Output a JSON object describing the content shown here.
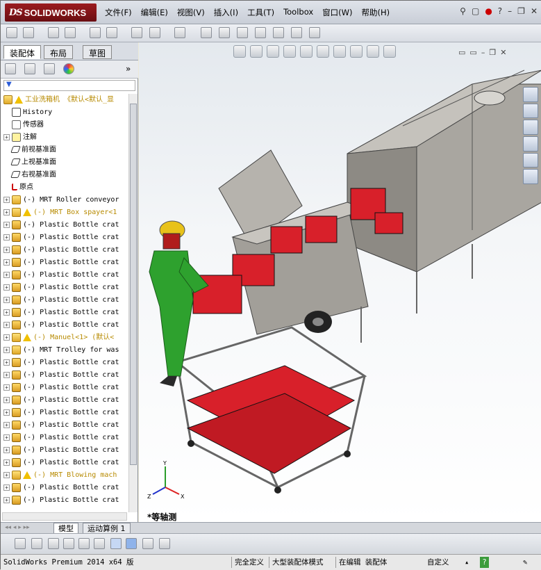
{
  "app": {
    "brand_ds": "DS",
    "brand_name": "SOLIDWORKS"
  },
  "menu": [
    "文件(F)",
    "编辑(E)",
    "视图(V)",
    "插入(I)",
    "工具(T)",
    "Toolbox",
    "窗口(W)",
    "帮助(H)"
  ],
  "panel": {
    "tabs": [
      "装配体",
      "布局",
      "草图"
    ],
    "root_label": "工业洗箱机  《默认<默认_显",
    "tree": [
      {
        "type": "history",
        "label": "History",
        "expandable": false,
        "warn": false,
        "color": "black"
      },
      {
        "type": "sensor",
        "label": "传感器",
        "expandable": false,
        "warn": false,
        "color": "black"
      },
      {
        "type": "annot",
        "label": "注解",
        "expandable": true,
        "warn": false,
        "color": "black"
      },
      {
        "type": "plane",
        "label": "前视基准面",
        "expandable": false,
        "warn": false,
        "color": "black"
      },
      {
        "type": "plane",
        "label": "上视基准面",
        "expandable": false,
        "warn": false,
        "color": "black"
      },
      {
        "type": "plane",
        "label": "右视基准面",
        "expandable": false,
        "warn": false,
        "color": "black"
      },
      {
        "type": "origin",
        "label": "原点",
        "expandable": false,
        "warn": false,
        "color": "black"
      },
      {
        "type": "asm",
        "label": "(-) MRT Roller conveyor",
        "expandable": true,
        "warn": false,
        "color": "black"
      },
      {
        "type": "asm",
        "label": "(-) MRT Box spayer<1",
        "expandable": true,
        "warn": true,
        "color": "yellow"
      },
      {
        "type": "part",
        "label": "(-) Plastic Bottle crat",
        "expandable": true,
        "warn": false,
        "color": "black"
      },
      {
        "type": "part",
        "label": "(-) Plastic Bottle crat",
        "expandable": true,
        "warn": false,
        "color": "black"
      },
      {
        "type": "part",
        "label": "(-) Plastic Bottle crat",
        "expandable": true,
        "warn": false,
        "color": "black"
      },
      {
        "type": "part",
        "label": "(-) Plastic Bottle crat",
        "expandable": true,
        "warn": false,
        "color": "black"
      },
      {
        "type": "part",
        "label": "(-) Plastic Bottle crat",
        "expandable": true,
        "warn": false,
        "color": "black"
      },
      {
        "type": "part",
        "label": "(-) Plastic Bottle crat",
        "expandable": true,
        "warn": false,
        "color": "black"
      },
      {
        "type": "part",
        "label": "(-) Plastic Bottle crat",
        "expandable": true,
        "warn": false,
        "color": "black"
      },
      {
        "type": "part",
        "label": "(-) Plastic Bottle crat",
        "expandable": true,
        "warn": false,
        "color": "black"
      },
      {
        "type": "part",
        "label": "(-) Plastic Bottle crat",
        "expandable": true,
        "warn": false,
        "color": "black"
      },
      {
        "type": "asm",
        "label": "(-) Manuel<1> (默认<",
        "expandable": true,
        "warn": true,
        "color": "yellow"
      },
      {
        "type": "asm",
        "label": "(-) MRT Trolley for was",
        "expandable": true,
        "warn": false,
        "color": "black"
      },
      {
        "type": "part",
        "label": "(-) Plastic Bottle crat",
        "expandable": true,
        "warn": false,
        "color": "black"
      },
      {
        "type": "part",
        "label": "(-) Plastic Bottle crat",
        "expandable": true,
        "warn": false,
        "color": "black"
      },
      {
        "type": "part",
        "label": "(-) Plastic Bottle crat",
        "expandable": true,
        "warn": false,
        "color": "black"
      },
      {
        "type": "part",
        "label": "(-) Plastic Bottle crat",
        "expandable": true,
        "warn": false,
        "color": "black"
      },
      {
        "type": "part",
        "label": "(-) Plastic Bottle crat",
        "expandable": true,
        "warn": false,
        "color": "black"
      },
      {
        "type": "part",
        "label": "(-) Plastic Bottle crat",
        "expandable": true,
        "warn": false,
        "color": "black"
      },
      {
        "type": "part",
        "label": "(-) Plastic Bottle crat",
        "expandable": true,
        "warn": false,
        "color": "black"
      },
      {
        "type": "part",
        "label": "(-) Plastic Bottle crat",
        "expandable": true,
        "warn": false,
        "color": "black"
      },
      {
        "type": "part",
        "label": "(-) Plastic Bottle crat",
        "expandable": true,
        "warn": false,
        "color": "black"
      },
      {
        "type": "asm",
        "label": "(-) MRT Blowing mach",
        "expandable": true,
        "warn": true,
        "color": "yellow"
      },
      {
        "type": "part",
        "label": "(-) Plastic Bottle crat",
        "expandable": true,
        "warn": false,
        "color": "black"
      },
      {
        "type": "part",
        "label": "(-) Plastic Bottle crat",
        "expandable": true,
        "warn": false,
        "color": "black"
      }
    ]
  },
  "viewport": {
    "view_name": "*等轴测",
    "axes": {
      "x": "X",
      "y": "Y",
      "z": "Z"
    }
  },
  "bottom_tabs": [
    "模型",
    "运动算例 1"
  ],
  "status": {
    "version": "SolidWorks Premium 2014 x64 版",
    "definition": "完全定义",
    "mode": "大型装配体模式",
    "editing": "在编辑 装配体",
    "custom": "自定义"
  },
  "colors": {
    "brand": "#8b1419",
    "crate_red": "#d8202a",
    "machine_gray": "#a9a6a0",
    "worker_green": "#2ea12e",
    "helmet_yellow": "#e8c21a"
  }
}
